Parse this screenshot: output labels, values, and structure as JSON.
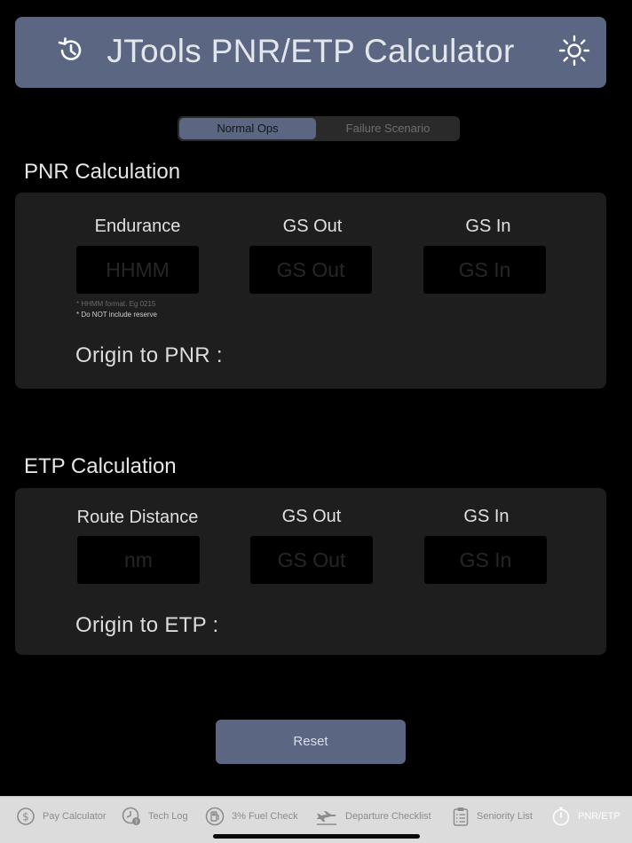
{
  "header": {
    "title": "JTools PNR/ETP Calculator",
    "history_icon": "history-icon",
    "settings_icon": "sun-icon"
  },
  "mode_selector": {
    "options": [
      "Normal Ops",
      "Failure Scenario"
    ],
    "selected": "Normal Ops"
  },
  "pnr": {
    "section_title": "PNR Calculation",
    "fields": [
      {
        "label": "Endurance",
        "placeholder": "HHMM",
        "value": ""
      },
      {
        "label": "GS Out",
        "placeholder": "GS Out",
        "value": ""
      },
      {
        "label": "GS In",
        "placeholder": "GS In",
        "value": ""
      }
    ],
    "hint_format": "* HHMM format.  Eg 0215",
    "hint_reserve": "* Do NOT include reserve",
    "result_label": "Origin to PNR :"
  },
  "etp": {
    "section_title": "ETP Calculation",
    "fields": [
      {
        "label": "Route Distance",
        "placeholder": "nm",
        "value": ""
      },
      {
        "label": "GS Out",
        "placeholder": "GS Out",
        "value": ""
      },
      {
        "label": "GS In",
        "placeholder": "GS In",
        "value": ""
      }
    ],
    "result_label": "Origin to ETP :"
  },
  "reset_label": "Reset",
  "tabbar": {
    "items": [
      {
        "label": "Pay Calculator",
        "icon": "dollar-circle-icon",
        "active": false
      },
      {
        "label": "Tech Log",
        "icon": "clock-question-icon",
        "active": false
      },
      {
        "label": "3% Fuel Check",
        "icon": "fuel-icon",
        "active": false
      },
      {
        "label": "Departure Checklist",
        "icon": "airplane-departure-icon",
        "active": false
      },
      {
        "label": "Seniority List",
        "icon": "clipboard-list-icon",
        "active": false
      },
      {
        "label": "PNR/ETP",
        "icon": "stopwatch-icon",
        "active": true
      }
    ]
  },
  "colors": {
    "accent": "#5b6782",
    "background": "#000000",
    "panel": "#1e1e1e",
    "tabbar": "#dcdcdc"
  }
}
